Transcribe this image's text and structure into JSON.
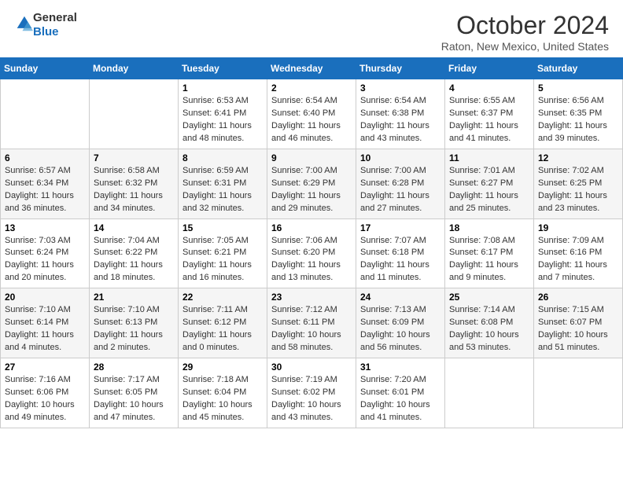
{
  "header": {
    "logo_line1": "General",
    "logo_line2": "Blue",
    "month": "October 2024",
    "location": "Raton, New Mexico, United States"
  },
  "days_of_week": [
    "Sunday",
    "Monday",
    "Tuesday",
    "Wednesday",
    "Thursday",
    "Friday",
    "Saturday"
  ],
  "weeks": [
    [
      {
        "day": "",
        "info": ""
      },
      {
        "day": "",
        "info": ""
      },
      {
        "day": "1",
        "info": "Sunrise: 6:53 AM\nSunset: 6:41 PM\nDaylight: 11 hours and 48 minutes."
      },
      {
        "day": "2",
        "info": "Sunrise: 6:54 AM\nSunset: 6:40 PM\nDaylight: 11 hours and 46 minutes."
      },
      {
        "day": "3",
        "info": "Sunrise: 6:54 AM\nSunset: 6:38 PM\nDaylight: 11 hours and 43 minutes."
      },
      {
        "day": "4",
        "info": "Sunrise: 6:55 AM\nSunset: 6:37 PM\nDaylight: 11 hours and 41 minutes."
      },
      {
        "day": "5",
        "info": "Sunrise: 6:56 AM\nSunset: 6:35 PM\nDaylight: 11 hours and 39 minutes."
      }
    ],
    [
      {
        "day": "6",
        "info": "Sunrise: 6:57 AM\nSunset: 6:34 PM\nDaylight: 11 hours and 36 minutes."
      },
      {
        "day": "7",
        "info": "Sunrise: 6:58 AM\nSunset: 6:32 PM\nDaylight: 11 hours and 34 minutes."
      },
      {
        "day": "8",
        "info": "Sunrise: 6:59 AM\nSunset: 6:31 PM\nDaylight: 11 hours and 32 minutes."
      },
      {
        "day": "9",
        "info": "Sunrise: 7:00 AM\nSunset: 6:29 PM\nDaylight: 11 hours and 29 minutes."
      },
      {
        "day": "10",
        "info": "Sunrise: 7:00 AM\nSunset: 6:28 PM\nDaylight: 11 hours and 27 minutes."
      },
      {
        "day": "11",
        "info": "Sunrise: 7:01 AM\nSunset: 6:27 PM\nDaylight: 11 hours and 25 minutes."
      },
      {
        "day": "12",
        "info": "Sunrise: 7:02 AM\nSunset: 6:25 PM\nDaylight: 11 hours and 23 minutes."
      }
    ],
    [
      {
        "day": "13",
        "info": "Sunrise: 7:03 AM\nSunset: 6:24 PM\nDaylight: 11 hours and 20 minutes."
      },
      {
        "day": "14",
        "info": "Sunrise: 7:04 AM\nSunset: 6:22 PM\nDaylight: 11 hours and 18 minutes."
      },
      {
        "day": "15",
        "info": "Sunrise: 7:05 AM\nSunset: 6:21 PM\nDaylight: 11 hours and 16 minutes."
      },
      {
        "day": "16",
        "info": "Sunrise: 7:06 AM\nSunset: 6:20 PM\nDaylight: 11 hours and 13 minutes."
      },
      {
        "day": "17",
        "info": "Sunrise: 7:07 AM\nSunset: 6:18 PM\nDaylight: 11 hours and 11 minutes."
      },
      {
        "day": "18",
        "info": "Sunrise: 7:08 AM\nSunset: 6:17 PM\nDaylight: 11 hours and 9 minutes."
      },
      {
        "day": "19",
        "info": "Sunrise: 7:09 AM\nSunset: 6:16 PM\nDaylight: 11 hours and 7 minutes."
      }
    ],
    [
      {
        "day": "20",
        "info": "Sunrise: 7:10 AM\nSunset: 6:14 PM\nDaylight: 11 hours and 4 minutes."
      },
      {
        "day": "21",
        "info": "Sunrise: 7:10 AM\nSunset: 6:13 PM\nDaylight: 11 hours and 2 minutes."
      },
      {
        "day": "22",
        "info": "Sunrise: 7:11 AM\nSunset: 6:12 PM\nDaylight: 11 hours and 0 minutes."
      },
      {
        "day": "23",
        "info": "Sunrise: 7:12 AM\nSunset: 6:11 PM\nDaylight: 10 hours and 58 minutes."
      },
      {
        "day": "24",
        "info": "Sunrise: 7:13 AM\nSunset: 6:09 PM\nDaylight: 10 hours and 56 minutes."
      },
      {
        "day": "25",
        "info": "Sunrise: 7:14 AM\nSunset: 6:08 PM\nDaylight: 10 hours and 53 minutes."
      },
      {
        "day": "26",
        "info": "Sunrise: 7:15 AM\nSunset: 6:07 PM\nDaylight: 10 hours and 51 minutes."
      }
    ],
    [
      {
        "day": "27",
        "info": "Sunrise: 7:16 AM\nSunset: 6:06 PM\nDaylight: 10 hours and 49 minutes."
      },
      {
        "day": "28",
        "info": "Sunrise: 7:17 AM\nSunset: 6:05 PM\nDaylight: 10 hours and 47 minutes."
      },
      {
        "day": "29",
        "info": "Sunrise: 7:18 AM\nSunset: 6:04 PM\nDaylight: 10 hours and 45 minutes."
      },
      {
        "day": "30",
        "info": "Sunrise: 7:19 AM\nSunset: 6:02 PM\nDaylight: 10 hours and 43 minutes."
      },
      {
        "day": "31",
        "info": "Sunrise: 7:20 AM\nSunset: 6:01 PM\nDaylight: 10 hours and 41 minutes."
      },
      {
        "day": "",
        "info": ""
      },
      {
        "day": "",
        "info": ""
      }
    ]
  ]
}
